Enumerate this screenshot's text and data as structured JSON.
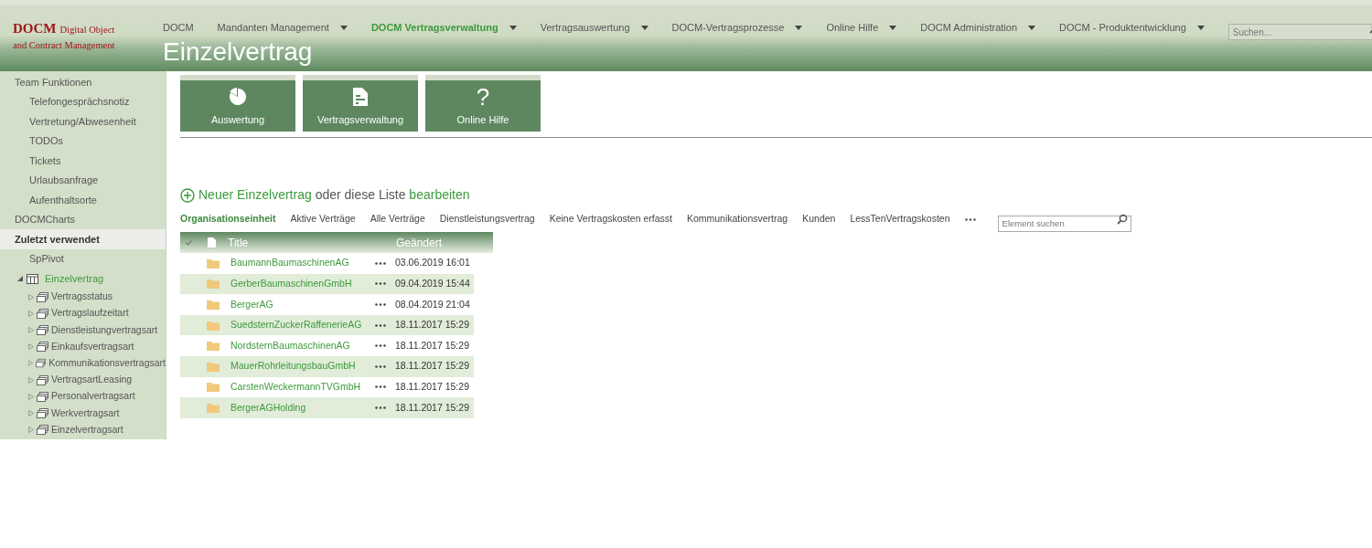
{
  "logo": {
    "brand": "DOCM",
    "line_1": "Digital Object",
    "line_2": "and Contract Management"
  },
  "nav": [
    {
      "label": "DOCM",
      "selected": false,
      "dropdown": false
    },
    {
      "label": "Mandanten Management",
      "selected": false,
      "dropdown": true
    },
    {
      "label": "DOCM Vertragsverwaltung",
      "selected": true,
      "dropdown": true
    },
    {
      "label": "Vertragsauswertung",
      "selected": false,
      "dropdown": true
    },
    {
      "label": "DOCM-Vertragsprozesse",
      "selected": false,
      "dropdown": true
    },
    {
      "label": "Online Hilfe",
      "selected": false,
      "dropdown": true
    },
    {
      "label": "DOCM Administration",
      "selected": false,
      "dropdown": true
    },
    {
      "label": "DOCM - Produktentwicklung",
      "selected": false,
      "dropdown": true
    }
  ],
  "search": {
    "placeholder": "Suchen..."
  },
  "page_title": "Einzelvertrag",
  "sidebar": [
    {
      "label": "Team Funktionen",
      "kind": "link",
      "selected": false,
      "children": [
        {
          "label": "Telefongesprächsnotiz",
          "kind": "link",
          "selected": false
        },
        {
          "label": "Vertretung/Abwesenheit",
          "kind": "link",
          "selected": false
        },
        {
          "label": "TODOs",
          "kind": "link",
          "selected": false
        },
        {
          "label": "Tickets",
          "kind": "link",
          "selected": false
        },
        {
          "label": "Urlaubsanfrage",
          "kind": "link",
          "selected": false
        },
        {
          "label": "Aufenthaltsorte",
          "kind": "link",
          "selected": false
        }
      ]
    },
    {
      "label": "DOCMCharts",
      "kind": "link",
      "selected": false
    },
    {
      "label": "Zuletzt verwendet",
      "kind": "link",
      "selected": true,
      "children": [
        {
          "label": "SpPivot",
          "kind": "link",
          "selected": false
        },
        {
          "label": "Einzelvertrag",
          "kind": "list",
          "selected": false,
          "expanded": true,
          "children": [
            {
              "label": "Vertragsstatus",
              "kind": "sublist",
              "selected": false,
              "expanded": false
            },
            {
              "label": "Vertragslaufzeitart",
              "kind": "sublist",
              "selected": false,
              "expanded": false
            },
            {
              "label": "Dienstleistungvertragsart",
              "kind": "sublist",
              "selected": false,
              "expanded": false
            },
            {
              "label": "Einkaufsvertragsart",
              "kind": "sublist",
              "selected": false,
              "expanded": false
            },
            {
              "label": "Kommunikationsvertragsart",
              "kind": "sublist",
              "selected": false,
              "expanded": false
            },
            {
              "label": "VertragsartLeasing",
              "kind": "sublist",
              "selected": false,
              "expanded": false
            },
            {
              "label": "Personalvertragsart",
              "kind": "sublist",
              "selected": false,
              "expanded": false
            },
            {
              "label": "Werkvertragsart",
              "kind": "sublist",
              "selected": false,
              "expanded": false
            },
            {
              "label": "Einzelvertragsart",
              "kind": "sublist",
              "selected": false,
              "expanded": false
            }
          ]
        }
      ]
    }
  ],
  "tiles": [
    {
      "label": "Auswertung",
      "kind": "pie"
    },
    {
      "label": "Vertragsverwaltung",
      "kind": "document"
    },
    {
      "label": "Online Hilfe",
      "kind": "help",
      "symbol": "?"
    }
  ],
  "new_item": {
    "link": "Neuer Einzelvertrag",
    "middle": "oder diese Liste",
    "edit_link": "bearbeiten"
  },
  "views": [
    {
      "label": "Organisationseinheit",
      "selected": true
    },
    {
      "label": "Aktive Verträge",
      "selected": false
    },
    {
      "label": "Alle Verträge",
      "selected": false
    },
    {
      "label": "Dienstleistungsvertrag",
      "selected": false
    },
    {
      "label": "Keine Vertragskosten erfasst",
      "selected": false
    },
    {
      "label": "Kommunikationsvertrag",
      "selected": false
    },
    {
      "label": "Kunden",
      "selected": false
    },
    {
      "label": "LessTenVertragskosten",
      "selected": false
    }
  ],
  "list_search": {
    "placeholder": "Element suchen"
  },
  "table": {
    "columns": [
      "Title",
      "Geändert"
    ],
    "rows": [
      {
        "title": "BaumannBaumaschinenAG",
        "modified": "03.06.2019 16:01"
      },
      {
        "title": "GerberBaumaschinenGmbH",
        "modified": "09.04.2019 15:44"
      },
      {
        "title": "BergerAG",
        "modified": "08.04.2019 21:04"
      },
      {
        "title": "SuedsternZuckerRaffenerieAG",
        "modified": "18.11.2017 15:29"
      },
      {
        "title": "NordsternBaumaschinenAG",
        "modified": "18.11.2017 15:29"
      },
      {
        "title": "MauerRohrleitungsbauGmbH",
        "modified": "18.11.2017 15:29"
      },
      {
        "title": "CarstenWeckermannTVGmbH",
        "modified": "18.11.2017 15:29"
      },
      {
        "title": "BergerAGHolding",
        "modified": "18.11.2017 15:29"
      }
    ]
  }
}
